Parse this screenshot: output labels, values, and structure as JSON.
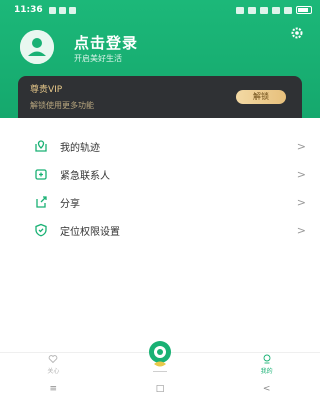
{
  "status_bar": {
    "time": "11:36"
  },
  "profile": {
    "login_title": "点击登录",
    "login_subtitle": "开启美好生活"
  },
  "vip": {
    "title": "尊贵VIP",
    "description": "解锁使用更多功能",
    "button_label": "解锁"
  },
  "menu": {
    "items": [
      {
        "label": "我的轨迹",
        "icon": "location-pin-icon"
      },
      {
        "label": "紧急联系人",
        "icon": "contact-add-icon"
      },
      {
        "label": "分享",
        "icon": "share-icon"
      },
      {
        "label": "定位权限设置",
        "icon": "shield-icon"
      }
    ],
    "chevron": ">"
  },
  "tabbar": {
    "tabs": [
      {
        "label": "关心",
        "icon": "heart-icon",
        "active": false
      },
      {
        "label": "",
        "icon": "location-fab-icon",
        "active": false
      },
      {
        "label": "我的",
        "icon": "user-icon",
        "active": true
      }
    ]
  },
  "navbar": {
    "menu_glyph": "≡",
    "home_glyph": "□",
    "back_glyph": "<"
  },
  "colors": {
    "brand_green": "#19b174",
    "vip_dark": "#2f3134",
    "vip_gold": "#e8c98a"
  }
}
